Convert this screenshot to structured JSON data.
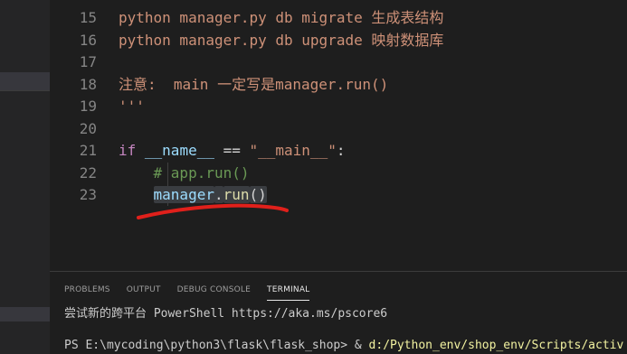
{
  "editor": {
    "lines": [
      {
        "num": "15",
        "tokens": [
          {
            "t": "python manager.py db migrate 生成表结构",
            "c": "c-doc"
          }
        ]
      },
      {
        "num": "16",
        "tokens": [
          {
            "t": "python manager.py db upgrade 映射数据库",
            "c": "c-doc"
          }
        ]
      },
      {
        "num": "17",
        "tokens": []
      },
      {
        "num": "18",
        "tokens": [
          {
            "t": "注意:  main 一定写是manager.run()",
            "c": "c-doc"
          }
        ]
      },
      {
        "num": "19",
        "tokens": [
          {
            "t": "'''",
            "c": "c-doc"
          }
        ]
      },
      {
        "num": "20",
        "tokens": []
      },
      {
        "num": "21",
        "tokens": [
          {
            "t": "if",
            "c": "c-kw"
          },
          {
            "t": " ",
            "c": "c-op"
          },
          {
            "t": "__name__",
            "c": "c-var"
          },
          {
            "t": " == ",
            "c": "c-op"
          },
          {
            "t": "\"__main__\"",
            "c": "c-str"
          },
          {
            "t": ":",
            "c": "c-op"
          }
        ]
      },
      {
        "num": "22",
        "tokens": [
          {
            "t": "    ",
            "c": "c-op"
          },
          {
            "t": "# app.run()",
            "c": "c-cmt"
          }
        ]
      },
      {
        "num": "23",
        "tokens": [
          {
            "t": "    ",
            "c": "c-op"
          },
          {
            "t": "manager",
            "c": "c-var sel"
          },
          {
            "t": ".",
            "c": "c-op sel"
          },
          {
            "t": "run",
            "c": "c-fn sel"
          },
          {
            "t": "()",
            "c": "c-op sel"
          }
        ]
      }
    ]
  },
  "panel": {
    "tabs": [
      {
        "label": "PROBLEMS",
        "active": false
      },
      {
        "label": "OUTPUT",
        "active": false
      },
      {
        "label": "DEBUG CONSOLE",
        "active": false
      },
      {
        "label": "TERMINAL",
        "active": true
      }
    ],
    "terminal": {
      "line1": "尝试新的跨平台 PowerShell https://aka.ms/pscore6",
      "line2_prompt": "PS E:\\mycoding\\python3\\flask\\flask_shop> & ",
      "line2_path": "d:/Python_env/shop_env/Scripts/activ"
    }
  },
  "colors": {
    "annotation_red": "#e0201b"
  }
}
